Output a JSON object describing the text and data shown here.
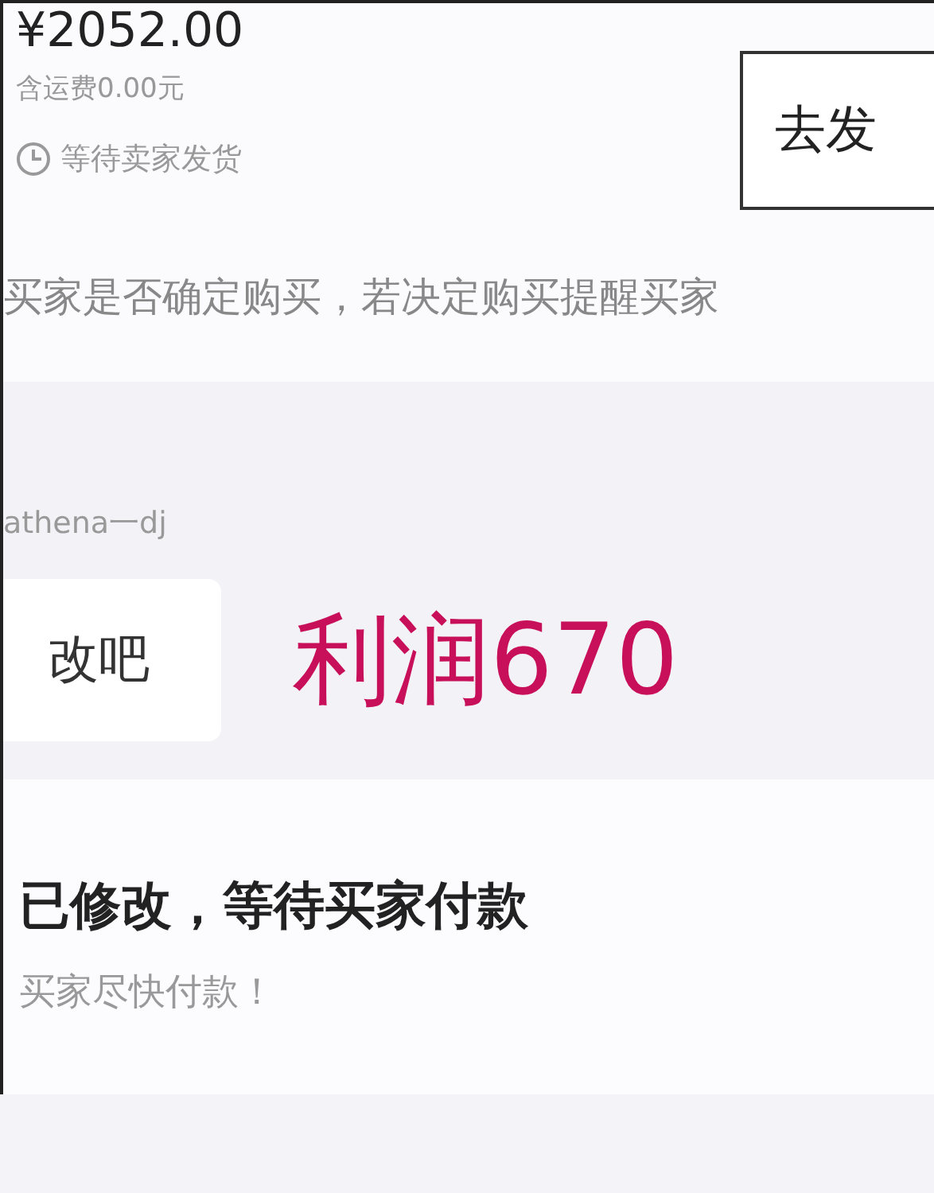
{
  "order": {
    "price": "¥2052.00",
    "shipping": "含运费0.00元",
    "status": "等待卖家发货",
    "button": "去发",
    "note": "买家是否确定购买，若决定购买提醒买家"
  },
  "chat": {
    "sender": "athena一dj",
    "message": "改吧",
    "overlay": "利润670"
  },
  "notice": {
    "title": "已修改，等待买家付款",
    "subtitle": "买家尽快付款！"
  }
}
